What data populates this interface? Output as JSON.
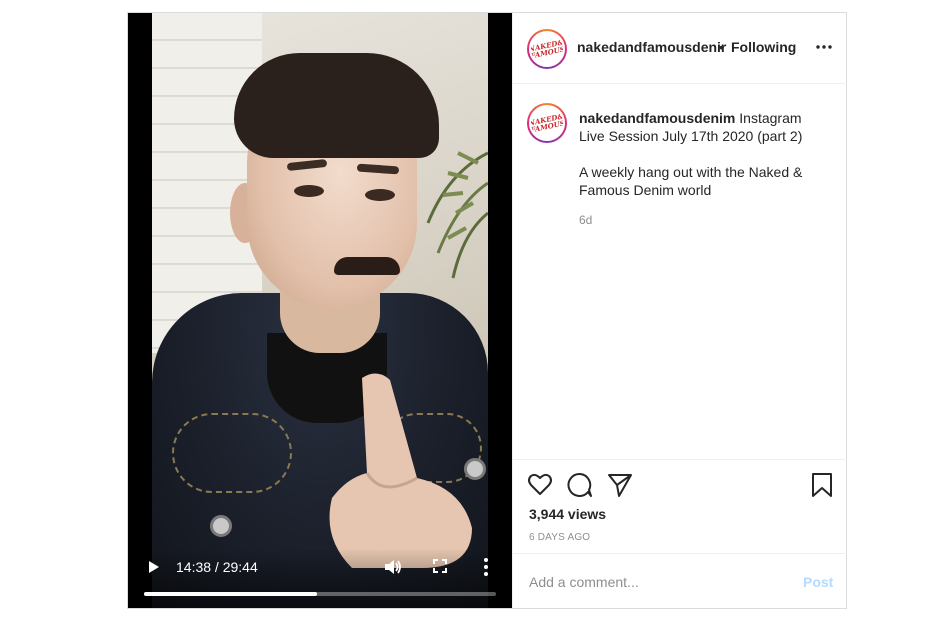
{
  "video": {
    "time_display": "14:38 / 29:44",
    "progress_fraction": 0.492
  },
  "header": {
    "username": "nakedandfamousdenir",
    "separator": "•",
    "follow_status": "Following",
    "avatar_logo_line1": "NAKED&",
    "avatar_logo_line2": "FAMOUS"
  },
  "caption": {
    "username": "nakedandfamousdenim",
    "title": "Instagram Live Session July 17th 2020 (part 2)",
    "description": "A weekly hang out with the Naked & Famous Denim world",
    "age": "6d"
  },
  "actions": {
    "views": "3,944 views",
    "date": "6 DAYS AGO"
  },
  "comment": {
    "placeholder": "Add a comment...",
    "post_label": "Post"
  },
  "icons": {
    "like": "heart-icon",
    "comment": "comment-bubble-icon",
    "share": "paper-plane-icon",
    "save": "bookmark-icon",
    "play": "play-icon",
    "volume": "volume-icon",
    "fullscreen": "fullscreen-icon"
  }
}
